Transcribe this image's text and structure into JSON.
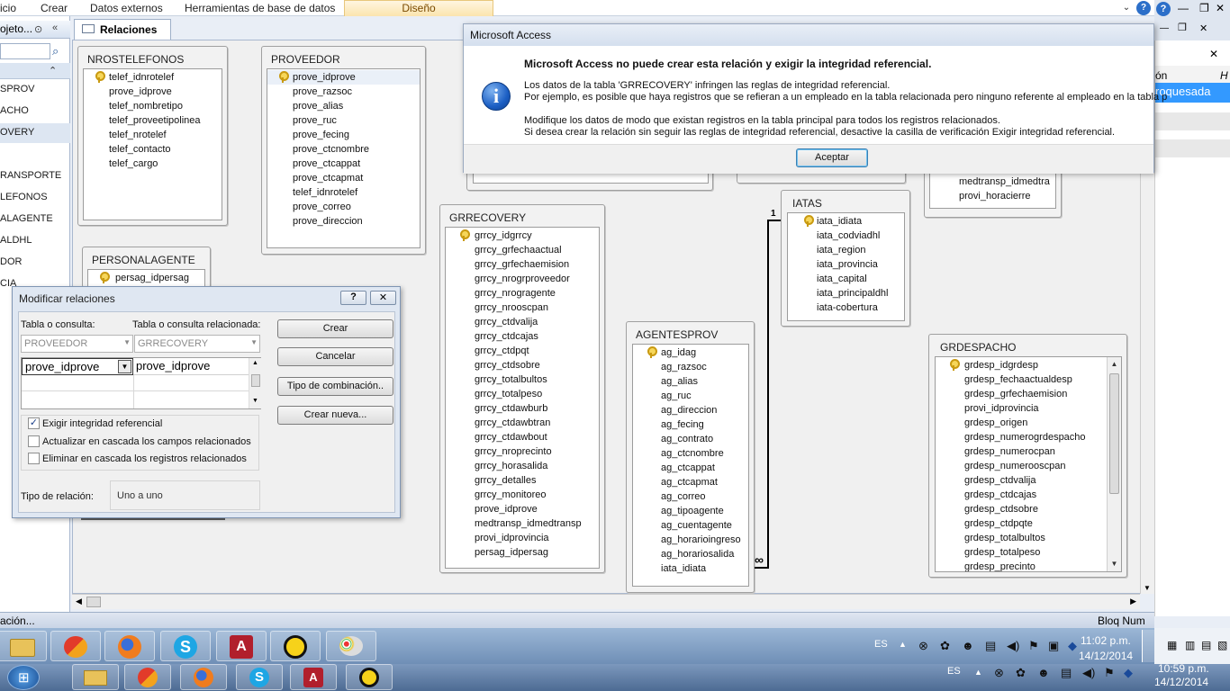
{
  "ribbon": {
    "tabs": [
      "icio",
      "Crear",
      "Datos externos",
      "Herramientas de base de datos"
    ],
    "context_tab": "Diseño"
  },
  "nav": {
    "header": "ojeto...",
    "items": [
      "SPROV",
      "ACHO",
      "OVERY",
      "RANSPORTE",
      "LEFONOS",
      "ALAGENTE",
      "ALDHL",
      "DOR",
      "CIA"
    ]
  },
  "doc_tab": {
    "label": "Relaciones"
  },
  "tables": {
    "nrotelefonos": {
      "name": "NROSTELEFONOS",
      "fields": [
        "telef_idnrotelef",
        "prove_idprove",
        "telef_nombretipo",
        "telef_proveetipolinea",
        "telef_nrotelef",
        "telef_contacto",
        "telef_cargo"
      ]
    },
    "proveedor": {
      "name": "PROVEEDOR",
      "fields": [
        "prove_idprove",
        "prove_razsoc",
        "prove_alias",
        "prove_ruc",
        "prove_fecing",
        "prove_ctcnombre",
        "prove_ctcappat",
        "prove_ctcapmat",
        "telef_idnrotelef",
        "prove_correo",
        "prove_direccion"
      ]
    },
    "personalagente": {
      "name": "PERSONALAGENTE",
      "fields": [
        "persag_idpersag"
      ]
    },
    "grrecovery": {
      "name": "GRRECOVERY",
      "fields": [
        "grrcy_idgrrcy",
        "grrcy_grfechaactual",
        "grrcy_grfechaemision",
        "grrcy_nrogrproveedor",
        "grrcy_nrogragente",
        "grrcy_nrooscpan",
        "grrcy_ctdvalija",
        "grrcy_ctdcajas",
        "grrcy_ctdpqt",
        "grrcy_ctdsobre",
        "grrcy_totalbultos",
        "grrcy_totalpeso",
        "grrcy_ctdawburb",
        "grrcy_ctdawbtran",
        "grrcy_ctdawbout",
        "grrcy_nroprecinto",
        "grrcy_horasalida",
        "grrcy_detalles",
        "grrcy_monitoreo",
        "prove_idprove",
        "medtransp_idmedtransp",
        "provi_idprovincia",
        "persag_idpersag"
      ]
    },
    "agentesprov": {
      "name": "AGENTESPROV",
      "fields": [
        "ag_idag",
        "ag_razsoc",
        "ag_alias",
        "ag_ruc",
        "ag_direccion",
        "ag_fecing",
        "ag_contrato",
        "ag_ctcnombre",
        "ag_ctcappat",
        "ag_ctcapmat",
        "ag_correo",
        "ag_tipoagente",
        "ag_cuentagente",
        "ag_horarioingreso",
        "ag_horariosalida",
        "iata_idiata"
      ]
    },
    "iatas": {
      "name": "IATAS",
      "fields": [
        "iata_idiata",
        "iata_codviadhl",
        "iata_region",
        "iata_provincia",
        "iata_capital",
        "iata_principaldhl",
        "iata-cobertura"
      ]
    },
    "grdespacho": {
      "name": "GRDESPACHO",
      "fields": [
        "grdesp_idgrdesp",
        "grdesp_fechaactualdesp",
        "grdesp_grfechaemision",
        "provi_idprovincia",
        "grdesp_origen",
        "grdesp_numerogrdespacho",
        "grdesp_numerocpan",
        "grdesp_numerooscpan",
        "grdesp_ctdvalija",
        "grdesp_ctdcajas",
        "grdesp_ctdsobre",
        "grdesp_ctdpqte",
        "grdesp_totalbultos",
        "grdesp_totalpeso",
        "grdesp_precinto"
      ]
    },
    "partial": {
      "fields": [
        "medtransp_idmedtra",
        "provi_horacierre"
      ]
    }
  },
  "relation_marks": {
    "one": "1",
    "many": "∞"
  },
  "msgbox": {
    "title": "Microsoft Access",
    "heading": "Microsoft Access no puede crear esta relación y exigir la integridad referencial.",
    "line1": "Los datos de la tabla 'GRRECOVERY' infringen las reglas de integridad referencial.",
    "line2": "Por ejemplo, es posible que haya registros que se refieran a un empleado en la tabla relacionada pero ninguno referente al empleado en la tabla p",
    "line3": "Modifique los datos de modo que existan registros en la tabla principal para todos los registros relacionados.",
    "line4": "Si desea crear la relación sin seguir las reglas de integridad referencial, desactive la casilla de verificación Exigir integridad referencial.",
    "ok_label": "Aceptar"
  },
  "dialog": {
    "title": "Modificar relaciones",
    "table_label": "Tabla o consulta:",
    "related_label": "Tabla o consulta relacionada:",
    "table_value": "PROVEEDOR",
    "related_value": "GRRECOVERY",
    "field_left": "prove_idprove",
    "field_right": "prove_idprove",
    "enforce_label": "Exigir integridad referencial",
    "enforce_checked": true,
    "cascade_update_label": "Actualizar en cascada los campos relacionados",
    "cascade_delete_label": "Eliminar en cascada los registros relacionados",
    "reltype_label": "Tipo de relación:",
    "reltype_value": "Uno a uno",
    "btn_create": "Crear",
    "btn_cancel": "Cancelar",
    "btn_join": "Tipo de combinación..",
    "btn_new": "Crear nueva..."
  },
  "right_pane": {
    "col_header": "ón",
    "col_header2": "H",
    "value": "roquesada"
  },
  "status": {
    "left": "ación...",
    "right": "Bloq Num"
  },
  "taskbar1": {
    "lang": "ES",
    "time": "11:02 p.m.",
    "date": "14/12/2014"
  },
  "taskbar2": {
    "lang": "ES",
    "time": "10:59 p.m.",
    "date": "14/12/2014"
  }
}
